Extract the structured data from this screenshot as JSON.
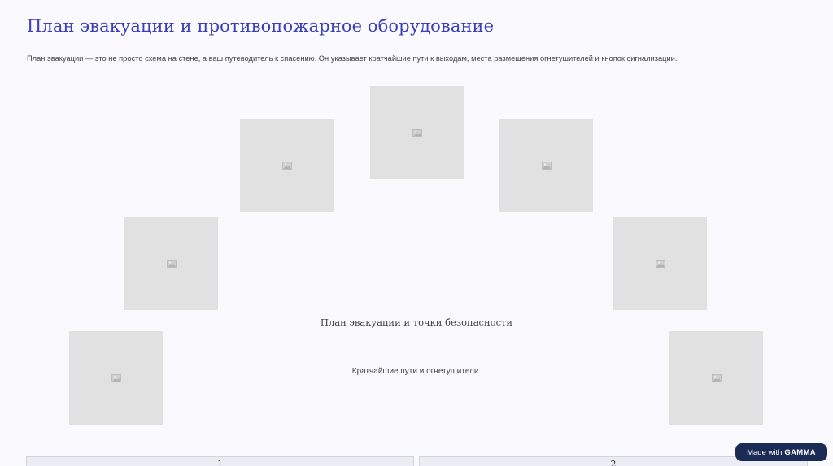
{
  "header": {
    "title": "План эвакуации и противопожарное оборудование",
    "intro": "План эвакуации — это не просто схема на стене, а ваш путеводитель к спасению. Он указывает кратчайшие пути к выходам, места размещения огнетушителей и кнопок сигнализации."
  },
  "center": {
    "title": "План эвакуации и точки безопасности",
    "subtitle": "Кратчайшие пути и огнетушители."
  },
  "images": {
    "icon": "image-placeholder-icon",
    "count": 7
  },
  "cards": [
    {
      "label": "1"
    },
    {
      "label": "2"
    }
  ],
  "badge": {
    "prefix": "Made with",
    "brand": "GAMMA"
  }
}
